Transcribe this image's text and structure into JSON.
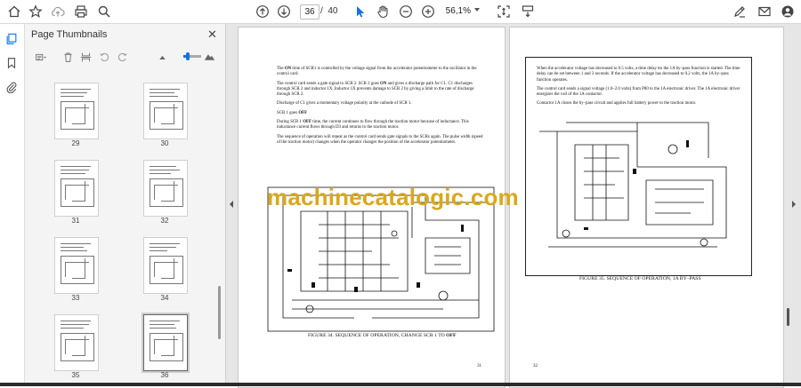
{
  "toolbar": {
    "page_current": "36",
    "page_separator": "/",
    "page_total": "40",
    "zoom": "56,1%"
  },
  "panel": {
    "title": "Page Thumbnails",
    "close_glyph": "✕",
    "thumbnails": [
      {
        "label": "29"
      },
      {
        "label": "30"
      },
      {
        "label": "31"
      },
      {
        "label": "32"
      },
      {
        "label": "33"
      },
      {
        "label": "34"
      },
      {
        "label": "35"
      },
      {
        "label": "36",
        "selected": true
      }
    ]
  },
  "left_page": {
    "paragraphs": [
      [
        "The ",
        {
          "b": "ON"
        },
        " time of SCR1 is controlled by the voltage signal from the accelerator potentiometer to the oscillator in the control card."
      ],
      [
        "The control card sends a gate signal to SCR 2. SCR 2 goes ",
        {
          "b": "ON"
        },
        " and gives a discharge path for C1. C1 discharges through SCR 2 and inductor 1X. Inductor 1X prevents damage to SCR 2 by giving a limit to the rate of discharge through SCR 2."
      ],
      [
        "Discharge of C1 gives a momentary voltage polarity at the cathode of SCR 1."
      ],
      [
        "SCR 1 goes ",
        {
          "b": "OFF"
        }
      ],
      [
        "During SCR 1 ",
        {
          "b": "OFF"
        },
        " time, the current continues to flow through the traction motor because of inductance. This inductance current flows through D3 and returns to the traction motor."
      ],
      [
        "The sequence of operation will repeat as the control card sends gate signals to the SCRs again. The pulse width (speed of the traction motor) changes when the operator changes the position of the accelerator potentiometer."
      ]
    ],
    "caption_prefix": "FIGURE 34. SEQUENCE OF OPERATION, CHANGE SCR 1 TO ",
    "caption_bold": "OFF",
    "page_number": "31"
  },
  "right_page": {
    "paragraphs": [
      [
        "When the accelerator voltage has decreased to 0.5 volts, a time delay tto the 1A by–pass  function is started. The time delay can be set between 1 and 3 seconds. If the accelerator voltage has decreased to 0.2 volts, the 1A by–pass function operates."
      ],
      [
        "The control card sends a signal voltage (1.0–2.0 volts) from P80 to the 1A electronic driver. The 1A electronic driver energizes the coil of the 1A contactor."
      ],
      [
        "Contactor 1A closes the by–pass circuit and applies full battery power to the traction motor."
      ]
    ],
    "caption": "FIGURE 35. SEQUENCE OF OPERATION, 1A BY–PASS",
    "page_number": "32"
  },
  "watermark": "machinecatalogic.com",
  "icons": {
    "home": "home-icon",
    "bookmark": "bookmark-star-icon",
    "upload": "cloud-upload-icon",
    "print": "print-icon",
    "search": "search-icon",
    "prev": "page-up-icon",
    "next": "page-down-icon",
    "select": "select-cursor-icon",
    "hand": "hand-icon",
    "zoom_out": "zoom-out-icon",
    "zoom_in": "zoom-in-icon",
    "fit": "fit-page-icon",
    "scroll_mode": "scroll-mode-icon",
    "sign": "sign-icon",
    "email": "email-icon",
    "account": "account-icon",
    "thumbnails": "thumbnails-icon",
    "bookmarks": "bookmarks-icon",
    "attachments": "attachment-icon"
  },
  "colors": {
    "accent": "#1473e6",
    "watermark": "#d9a81c"
  }
}
